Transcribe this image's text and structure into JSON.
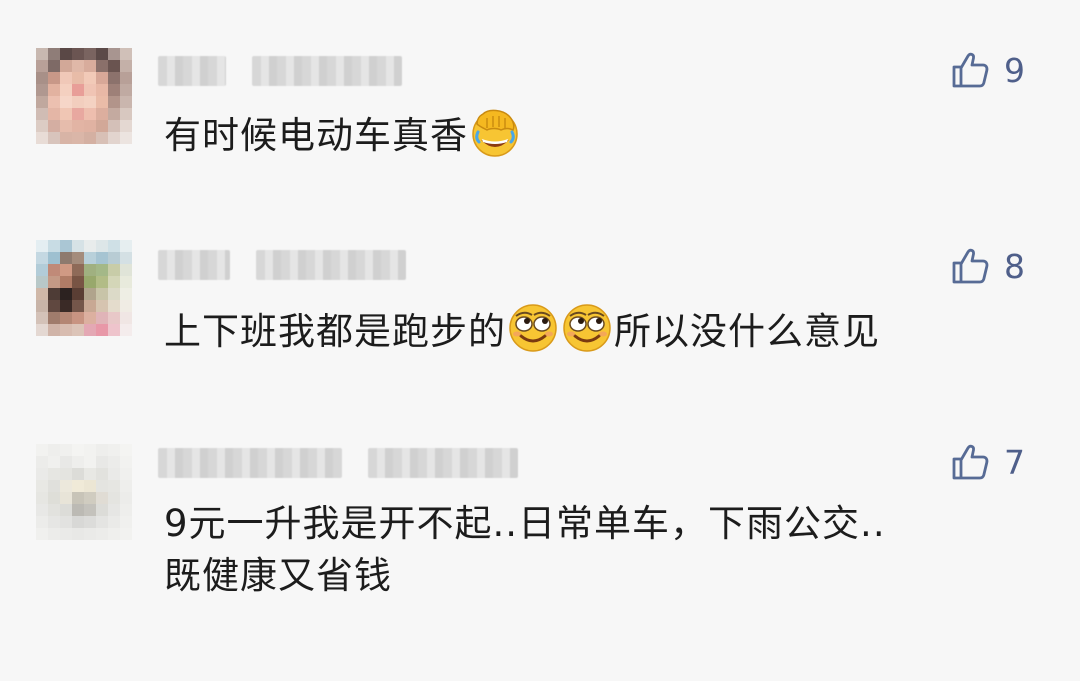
{
  "comments": [
    {
      "author_redacted": true,
      "likes": "9",
      "text_before_emoji": "有时候电动车真香",
      "emoji_1": "facepalm-laugh-emoji",
      "text_after_emoji": ""
    },
    {
      "author_redacted": true,
      "likes": "8",
      "text_before_emoji": "上下班我都是跑步的",
      "emoji_1": "smug-grin-emoji",
      "emoji_2": "smug-grin-emoji",
      "text_after_emoji": "所以没什么意见"
    },
    {
      "author_redacted": true,
      "likes": "7",
      "line_1": "9元一升我是开不起..日常单车，下雨公交..",
      "line_2": "既健康又省钱"
    }
  ],
  "colors": {
    "background": "#f7f7f7",
    "like_icon": "#576b95",
    "text": "#1c1c1c"
  },
  "icons": {
    "like": "thumbs-up-outline-icon"
  }
}
